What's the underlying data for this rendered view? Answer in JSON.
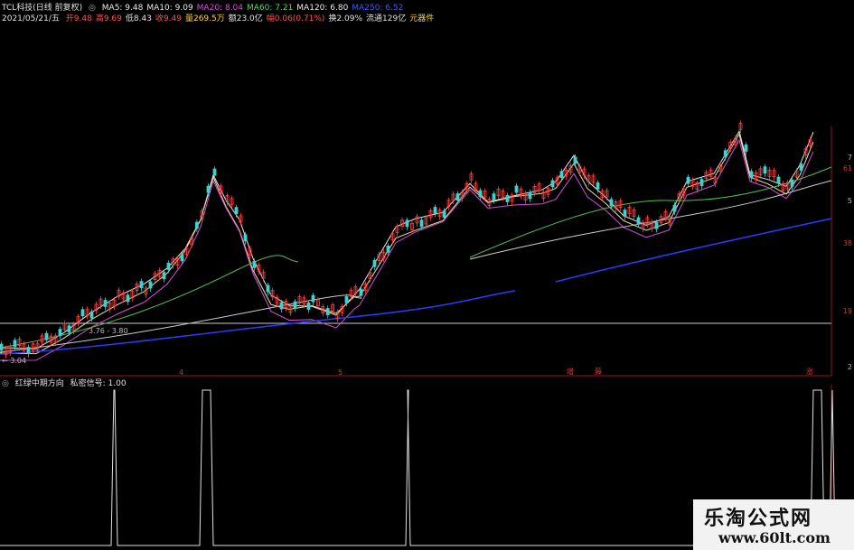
{
  "header": {
    "stock_title": "TCL科技(日线 前复权)",
    "ma": [
      {
        "label": "MA5: 9.48",
        "color": "#e8e8e8"
      },
      {
        "label": "MA10: 9.09",
        "color": "#e8e8e8"
      },
      {
        "label": "MA20: 8.04",
        "color": "#d64fd6"
      },
      {
        "label": "MA60: 7.21",
        "color": "#5bd65b"
      },
      {
        "label": "MA120: 6.80",
        "color": "#e8e8e8"
      },
      {
        "label": "MA250: 6.52",
        "color": "#3a5bff"
      }
    ],
    "date": "2021/05/21/五",
    "quote": [
      {
        "label": "开9.48",
        "color": "#ff5050"
      },
      {
        "label": "高9.69",
        "color": "#ff5050"
      },
      {
        "label": "低8.43",
        "color": "#e0e0e0"
      },
      {
        "label": "收9.49",
        "color": "#ff5050"
      },
      {
        "label": "量269.5万",
        "color": "#ffd24a"
      },
      {
        "label": "额23.0亿",
        "color": "#e0e0e0"
      },
      {
        "label": "幅0.06(0.71%)",
        "color": "#ff5050"
      },
      {
        "label": "换2.09%",
        "color": "#e0e0e0"
      },
      {
        "label": "流通129亿",
        "color": "#e0e0e0"
      },
      {
        "label": "元器件",
        "color": "#ffd24a"
      }
    ]
  },
  "axis": {
    "ticks": [
      "61",
      "5",
      "38",
      "19",
      "2"
    ],
    "top_ticks": [
      "7"
    ]
  },
  "annotations": {
    "range_label": "3.76 - 3.80",
    "low_label": "← 3.04"
  },
  "markers": [
    {
      "text": "4",
      "color": "#d23a3a"
    },
    {
      "text": "5",
      "color": "#d23a3a"
    },
    {
      "text": "增",
      "color": "#d23a3a"
    },
    {
      "text": "藤",
      "color": "#d23a3a"
    },
    {
      "text": "涨",
      "color": "#d23a3a"
    }
  ],
  "indicator": {
    "title": "红绿中期方向",
    "signal": "私密信号: 1.00"
  },
  "watermark": {
    "name": "乐淘公式网",
    "url": "www.60lt.com"
  }
}
